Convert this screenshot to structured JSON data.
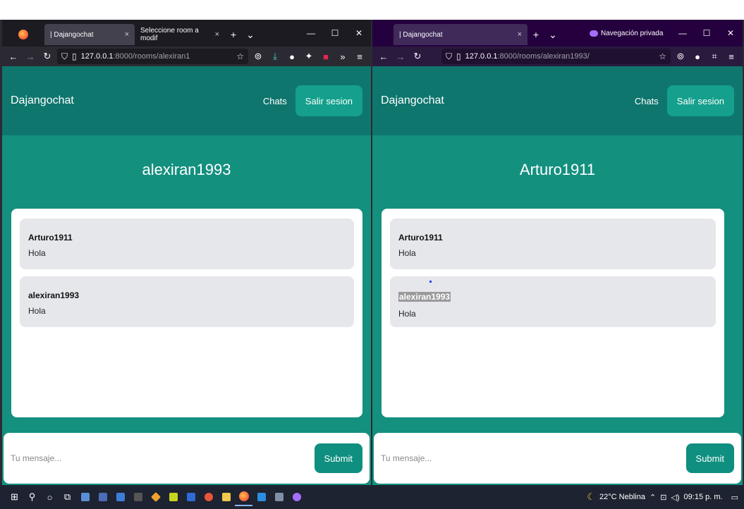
{
  "colors": {
    "accent": "#14907f",
    "header": "#0f766e",
    "button": "#14a08c"
  },
  "left": {
    "tabs": [
      {
        "label": "| Dajangochat",
        "close": "×"
      },
      {
        "label": "Seleccione room a modif",
        "close": "×"
      }
    ],
    "url_host": "127.0.0.1",
    "url_path": ":8000/rooms/alexiran1",
    "brand": "Dajangochat",
    "chats_link": "Chats",
    "logout_label": "Salir sesion",
    "room_title": "alexiran1993",
    "messages": [
      {
        "author": "Arturo1911",
        "text": "Hola"
      },
      {
        "author": "alexiran1993",
        "text": "Hola"
      }
    ],
    "input_placeholder": "Tu mensaje...",
    "submit_label": "Submit"
  },
  "right": {
    "tabs": [
      {
        "label": "| Dajangochat",
        "close": "×"
      }
    ],
    "private_label": "Navegación privada",
    "url_host": "127.0.0.1",
    "url_path": ":8000/rooms/alexiran1993/",
    "brand": "Dajangochat",
    "chats_link": "Chats",
    "logout_label": "Salir sesion",
    "room_title": "Arturo1911",
    "messages": [
      {
        "author": "Arturo1911",
        "text": "Hola"
      },
      {
        "author": "alexiran1993",
        "text": "Hola"
      }
    ],
    "input_placeholder": "Tu mensaje...",
    "submit_label": "Submit"
  },
  "taskbar": {
    "weather": "22°C  Neblina",
    "clock": "09:15 p. m."
  }
}
